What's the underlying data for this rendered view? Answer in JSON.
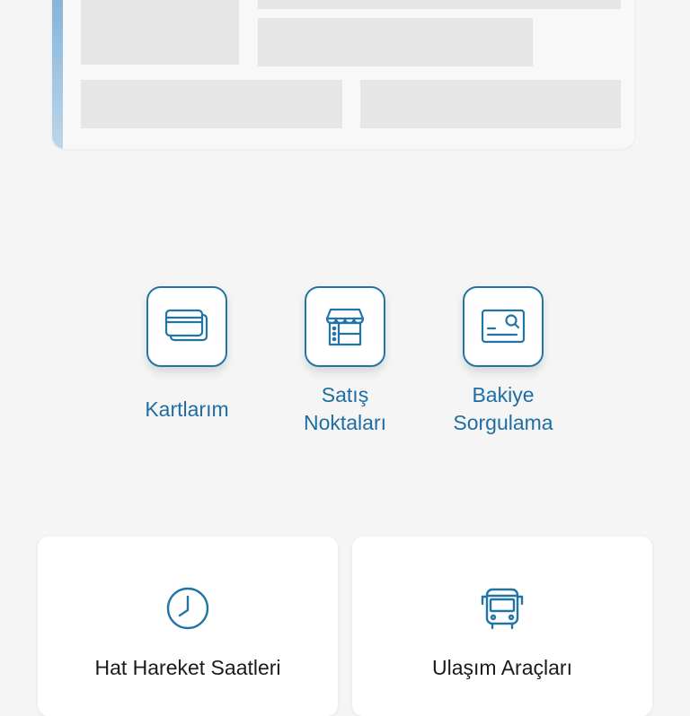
{
  "quick_actions": [
    {
      "label": "Kartlarım",
      "icon": "cards-icon"
    },
    {
      "label_line1": "Satış",
      "label_line2": "Noktaları",
      "icon": "store-icon"
    },
    {
      "label_line1": "Bakiye",
      "label_line2": "Sorgulama",
      "icon": "balance-card-search-icon"
    }
  ],
  "cards": [
    {
      "title": "Hat Hareket Saatleri",
      "icon": "clock-icon"
    },
    {
      "title": "Ulaşım Araçları",
      "icon": "bus-icon"
    }
  ],
  "colors": {
    "accent": "#2274a5",
    "label": "#1f6ea3",
    "background": "#f5f5f5",
    "skeleton": "#e6e6e6"
  }
}
